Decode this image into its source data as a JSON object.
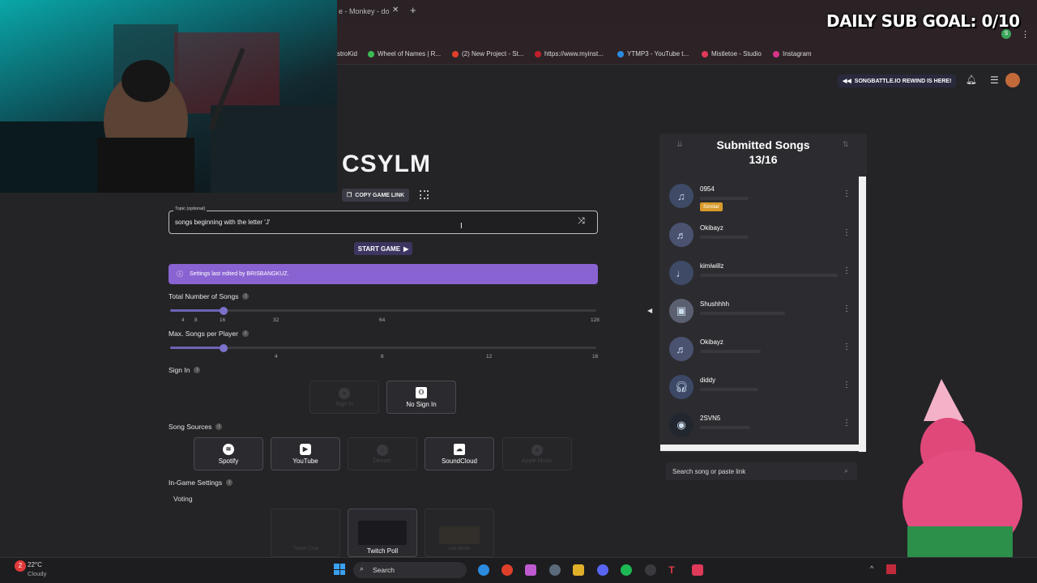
{
  "stream_overlay": {
    "sub_goal": "DAILY SUB GOAL: 0/10"
  },
  "browser": {
    "active_tab": "e - Monkey - do",
    "bookmarks": [
      "stroKid",
      "Wheel of Names | R...",
      "(2) New Project - St...",
      "https://www.myinst...",
      "YTMP3 - YouTube t...",
      "Mistletoe - Studio",
      "Instagram"
    ]
  },
  "header": {
    "rewind_label": "SONGBATTLE.IO REWIND IS HERE!"
  },
  "game": {
    "code": "CSYLM",
    "copy_link_label": "COPY GAME LINK",
    "topic_label": "Topic (optional)",
    "topic_value": "songs beginning with the letter 'J'",
    "start_label": "START GAME",
    "banner_text": "Settings last edited by BRISBANGKUZ."
  },
  "settings": {
    "total_songs": {
      "label": "Total Number of Songs",
      "ticks": [
        "4",
        "8",
        "16",
        "32",
        "64",
        "128"
      ],
      "value": 16
    },
    "max_per_player": {
      "label": "Max. Songs per Player",
      "ticks": [
        "4",
        "8",
        "12",
        "16"
      ],
      "value": 4
    },
    "sign_in": {
      "label": "Sign In",
      "options": [
        "Sign In",
        "No Sign In"
      ],
      "selected": "No Sign In"
    },
    "song_sources": {
      "label": "Song Sources",
      "options": [
        "Spotify",
        "YouTube",
        "Deezer",
        "SoundCloud",
        "Apple Music"
      ]
    },
    "in_game": {
      "label": "In-Game Settings",
      "voting_label": "Voting",
      "voting_options": [
        "Twitch Chat",
        "Twitch Poll",
        "Lite Mode"
      ]
    }
  },
  "submitted": {
    "title": "Submitted Songs",
    "count": "13/16",
    "similar_badge": "Similar",
    "songs": [
      {
        "user": "0954"
      },
      {
        "user": "Okibayz"
      },
      {
        "user": "kimiwillz"
      },
      {
        "user": "Shushhhh"
      },
      {
        "user": "Okibayz"
      },
      {
        "user": "diddy"
      },
      {
        "user": "2SVN5"
      }
    ],
    "search_placeholder": "Search song or paste link"
  },
  "taskbar": {
    "weather_temp": "22°C",
    "weather_desc": "Cloudy",
    "search_label": "Search",
    "notification_count": "2"
  },
  "colors": {
    "accent": "#8a63d2",
    "slider": "#6c63b5",
    "page_bg": "#242427"
  }
}
